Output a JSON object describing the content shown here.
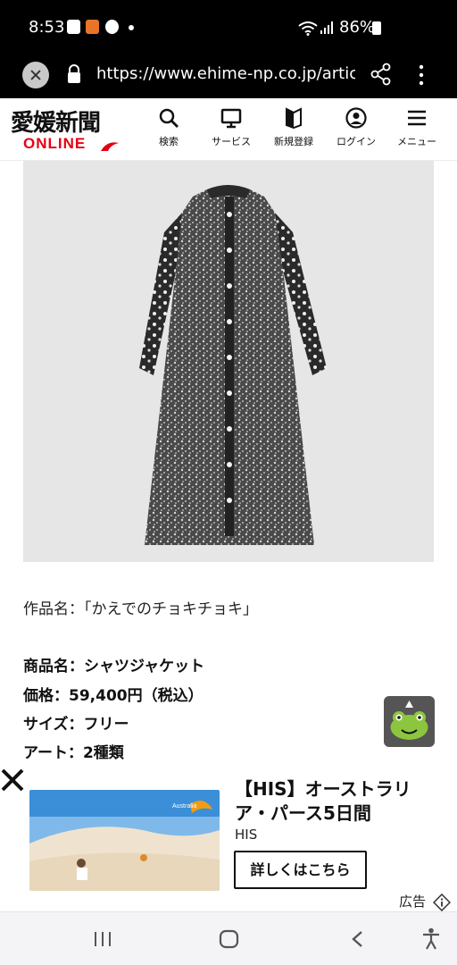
{
  "status_bar": {
    "time": "8:53",
    "battery": "86%",
    "icons": [
      "app-icon",
      "app-icon",
      "app-icon",
      "dot-icon",
      "wifi-icon",
      "signal-icon",
      "battery-icon"
    ]
  },
  "browser": {
    "url": "https://www.ehime-np.co.jp/artic",
    "icons": [
      "close-icon",
      "lock-icon",
      "share-icon",
      "more-vertical-icon"
    ]
  },
  "site": {
    "logo_main": "愛媛新聞",
    "logo_sub": "ONLINE",
    "brand_color": "#e60012",
    "nav": [
      {
        "label": "検索",
        "icon": "search-icon"
      },
      {
        "label": "サービス",
        "icon": "monitor-icon"
      },
      {
        "label": "新規登録",
        "icon": "bookmark-icon"
      },
      {
        "label": "ログイン",
        "icon": "user-icon"
      },
      {
        "label": "メニュー",
        "icon": "menu-icon"
      }
    ]
  },
  "article": {
    "image_subject": "dress-image",
    "work_name": "作品名：「かえでのチョキチョキ」",
    "specs": [
      "商品名：シャツジャケット",
      "価格：59,400円（税込）",
      "サイズ：フリー",
      "アート：2種類"
    ],
    "mascot_icon": "mascot-icon"
  },
  "ad": {
    "title": "【HIS】オーストラリア・パース5日間",
    "advertiser": "HIS",
    "cta": "詳しくはこちら",
    "label": "広告",
    "image_text": "Australia"
  },
  "nav_bar": {
    "icons": [
      "recent-apps-icon",
      "home-icon",
      "back-icon",
      "accessibility-icon"
    ]
  }
}
